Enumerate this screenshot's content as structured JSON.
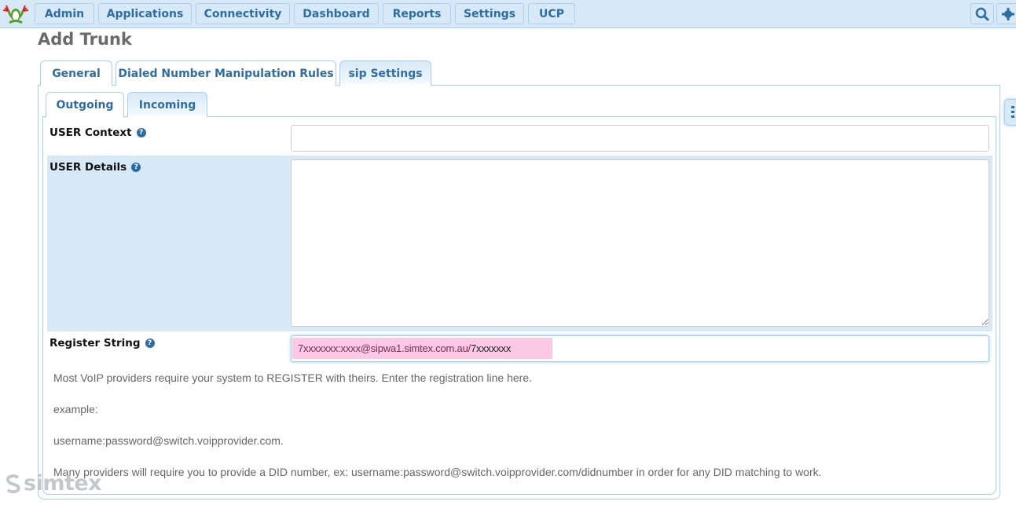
{
  "nav": {
    "items": [
      {
        "label": "Admin"
      },
      {
        "label": "Applications"
      },
      {
        "label": "Connectivity"
      },
      {
        "label": "Dashboard"
      },
      {
        "label": "Reports"
      },
      {
        "label": "Settings"
      },
      {
        "label": "UCP"
      }
    ],
    "icons": {
      "search": "search-icon",
      "settings": "gear-icon"
    }
  },
  "page": {
    "title": "Add Trunk"
  },
  "tabs": [
    {
      "label": "General",
      "active": false
    },
    {
      "label": "Dialed Number Manipulation Rules",
      "active": false
    },
    {
      "label": "sip Settings",
      "active": true
    }
  ],
  "subtabs": [
    {
      "label": "Outgoing",
      "active": false
    },
    {
      "label": "Incoming",
      "active": true
    }
  ],
  "form": {
    "user_context": {
      "label": "USER Context",
      "value": ""
    },
    "user_details": {
      "label": "USER Details",
      "value": ""
    },
    "register_string": {
      "label": "Register String",
      "value_prefix": "7xxxxxxx:xxxx@sipwa1.simtex.com.au/",
      "value_suffix": "7xxxxxxx"
    },
    "help_icon": "?"
  },
  "help": {
    "line1": "Most VoIP providers require your system to REGISTER with theirs. Enter the registration line here.",
    "line2": "example:",
    "line3": "username:password@switch.voipprovider.com.",
    "line4": "Many providers will require you to provide a DID number, ex: username:password@switch.voipprovider.com/didnumber in order for any DID matching to work."
  },
  "watermark": {
    "text": "simtex"
  }
}
